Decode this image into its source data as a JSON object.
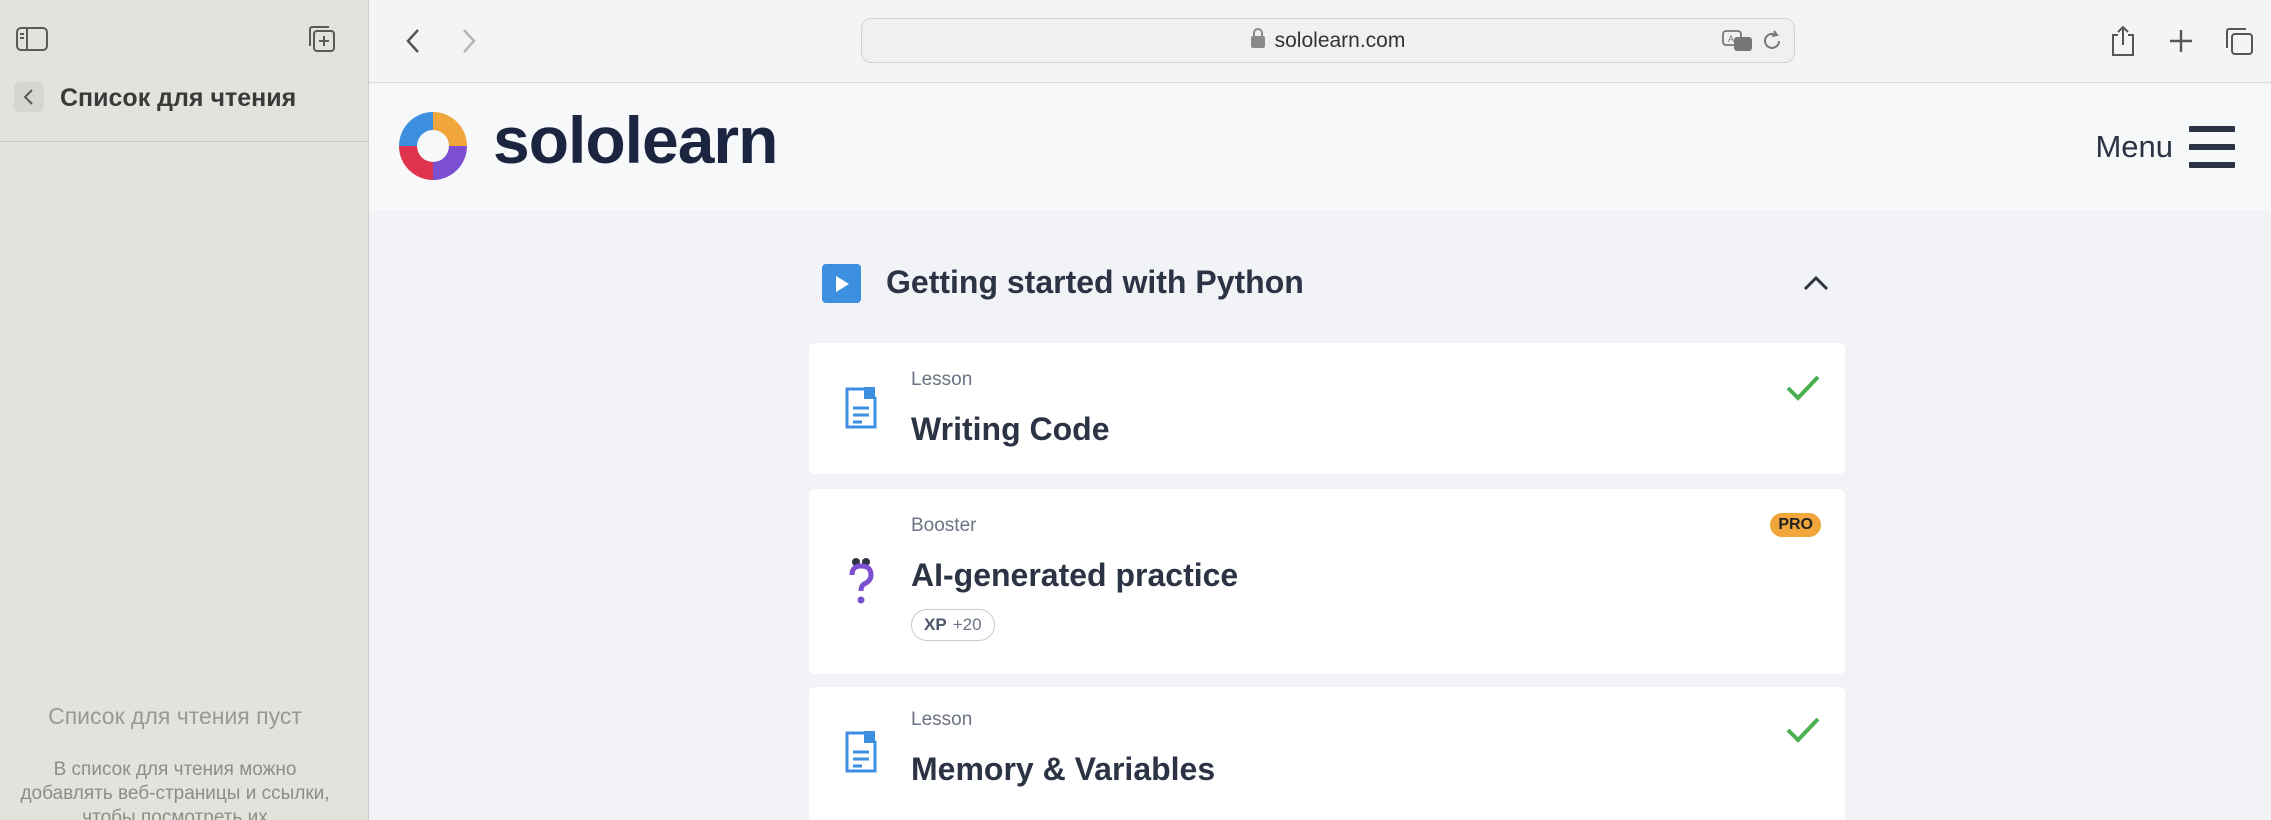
{
  "sidebar": {
    "title": "Список для чтения",
    "empty_title": "Список для чтения пуст",
    "empty_desc": "В список для чтения можно добавлять веб-страницы и ссылки, чтобы посмотреть их"
  },
  "browser": {
    "url": "sololearn.com"
  },
  "site": {
    "logo_text": "sololearn",
    "menu_label": "Menu"
  },
  "module": {
    "title": "Getting started with Python"
  },
  "items": [
    {
      "kind": "Lesson",
      "title": "Writing Code",
      "completed": true
    },
    {
      "kind": "Booster",
      "title": "AI-generated practice",
      "badge": "PRO",
      "xp_label": "XP",
      "xp_value": "+20"
    },
    {
      "kind": "Lesson",
      "title": "Memory & Variables",
      "completed": true
    }
  ],
  "colors": {
    "accent_blue": "#3d8fe0",
    "check_green": "#4caf50",
    "pro_orange": "#f0a63a"
  }
}
